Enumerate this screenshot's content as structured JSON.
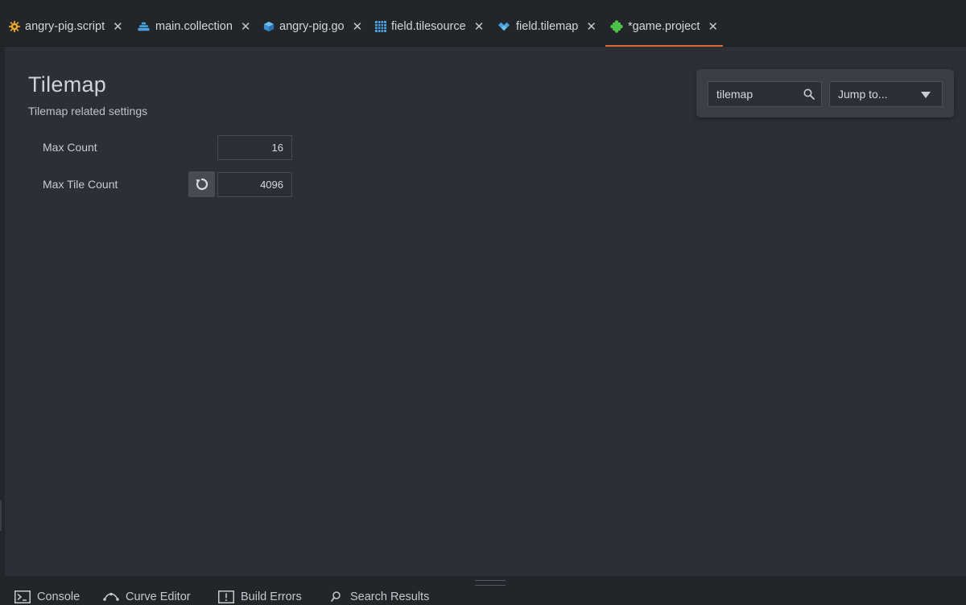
{
  "tabs": [
    {
      "label": "angry-pig.script",
      "icon": "gear-icon",
      "close": "✕",
      "active": false
    },
    {
      "label": "main.collection",
      "icon": "collection-icon",
      "close": "✕",
      "active": false
    },
    {
      "label": "angry-pig.go",
      "icon": "cube-icon",
      "close": "✕",
      "active": false
    },
    {
      "label": "field.tilesource",
      "icon": "grid-icon",
      "close": "✕",
      "active": false
    },
    {
      "label": "field.tilemap",
      "icon": "tilemap-icon",
      "close": "✕",
      "active": false
    },
    {
      "label": "*game.project",
      "icon": "puzzle-icon",
      "close": "✕",
      "active": true
    }
  ],
  "section": {
    "title": "Tilemap",
    "subtitle": "Tilemap related settings"
  },
  "properties": [
    {
      "label": "Max Count",
      "value": "16",
      "modified": false
    },
    {
      "label": "Max Tile Count",
      "value": "4096",
      "modified": true
    }
  ],
  "search": {
    "value": "tilemap",
    "jump_label": "Jump to..."
  },
  "bottom_tabs": [
    {
      "label": "Console",
      "icon": "console-icon"
    },
    {
      "label": "Curve Editor",
      "icon": "curve-icon"
    },
    {
      "label": "Build Errors",
      "icon": "error-icon"
    },
    {
      "label": "Search Results",
      "icon": "search-icon"
    }
  ],
  "colors": {
    "accent": "#e0673a",
    "background": "#2c2f35",
    "tabbar": "#22252a"
  }
}
